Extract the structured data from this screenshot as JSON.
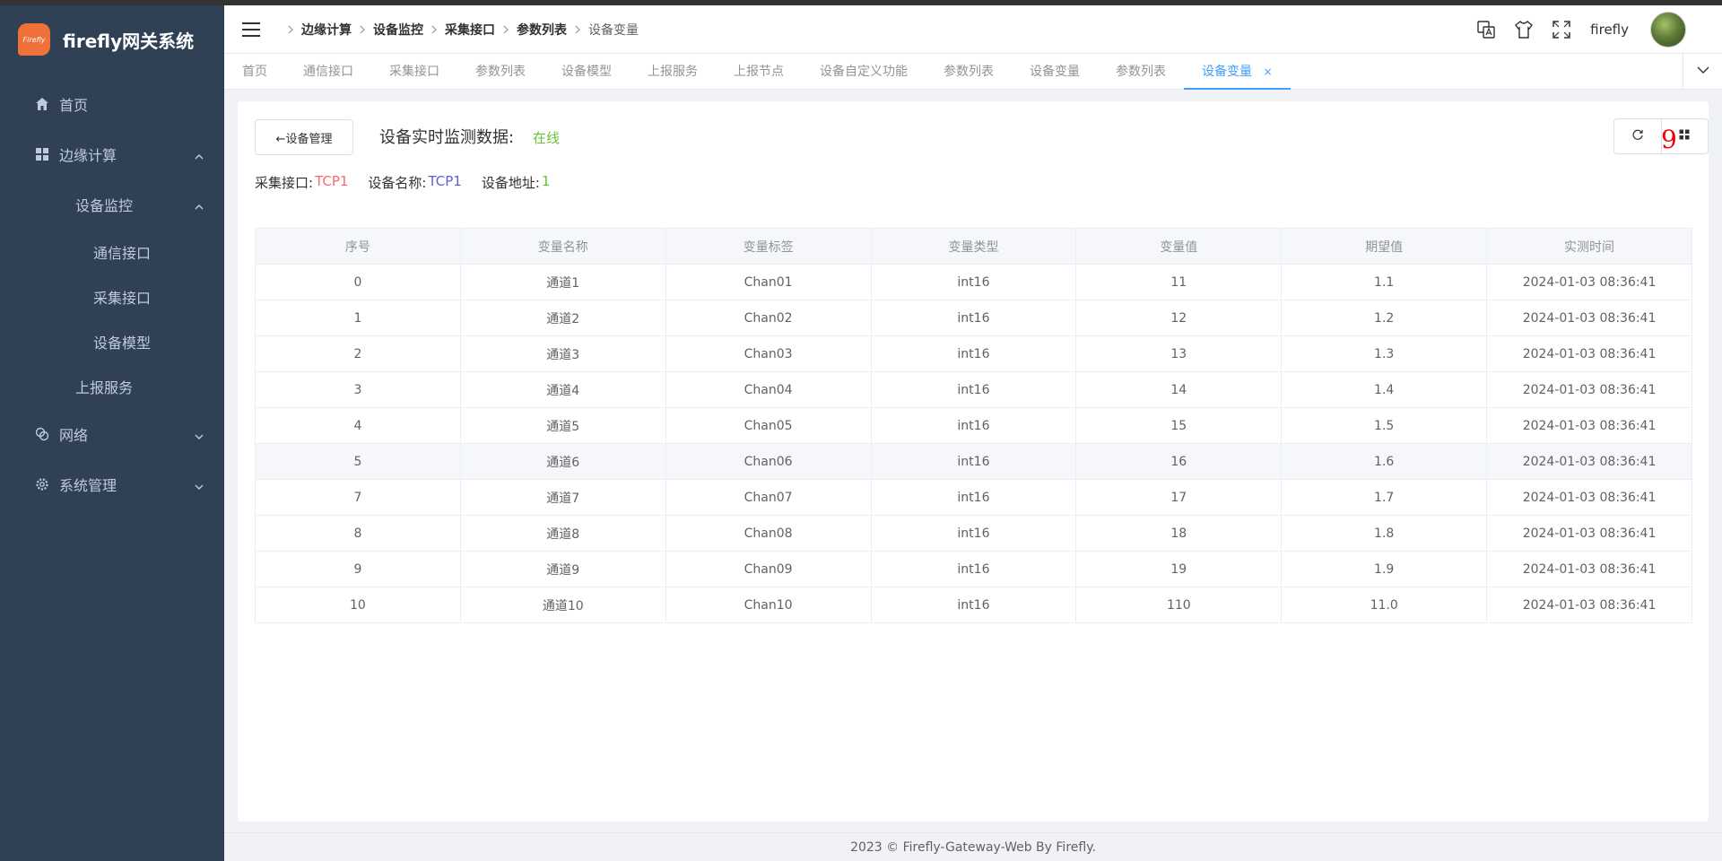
{
  "app": {
    "title": "firefly网关系统",
    "logo_text": "Firefly"
  },
  "sidebar": {
    "home": "首页",
    "edge": "边缘计算",
    "device_monitor": "设备监控",
    "comm_interface": "通信接口",
    "collect_interface": "采集接口",
    "device_model": "设备模型",
    "report_service": "上报服务",
    "network": "网络",
    "system_mgmt": "系统管理"
  },
  "breadcrumb": [
    "边缘计算",
    "设备监控",
    "采集接口",
    "参数列表",
    "设备变量"
  ],
  "header": {
    "username": "firefly"
  },
  "tabs": [
    {
      "label": "首页"
    },
    {
      "label": "通信接口"
    },
    {
      "label": "采集接口"
    },
    {
      "label": "参数列表"
    },
    {
      "label": "设备模型"
    },
    {
      "label": "上报服务"
    },
    {
      "label": "上报节点"
    },
    {
      "label": "设备自定义功能"
    },
    {
      "label": "参数列表"
    },
    {
      "label": "设备变量"
    },
    {
      "label": "参数列表"
    },
    {
      "label": "设备变量",
      "close": "×"
    }
  ],
  "main": {
    "back_label": "←设备管理",
    "monitor_title": "设备实时监测数据:",
    "status": "在线",
    "collect_label": "采集接口:",
    "collect_value": "TCP1",
    "device_name_label": "设备名称:",
    "device_name_value": "TCP1",
    "device_addr_label": "设备地址:",
    "device_addr_value": "1",
    "tool_number": "9"
  },
  "table": {
    "headers": [
      "序号",
      "变量名称",
      "变量标签",
      "变量类型",
      "变量值",
      "期望值",
      "实测时间"
    ],
    "rows": [
      [
        "0",
        "通道1",
        "Chan01",
        "int16",
        "11",
        "1.1",
        "2024-01-03 08:36:41"
      ],
      [
        "1",
        "通道2",
        "Chan02",
        "int16",
        "12",
        "1.2",
        "2024-01-03 08:36:41"
      ],
      [
        "2",
        "通道3",
        "Chan03",
        "int16",
        "13",
        "1.3",
        "2024-01-03 08:36:41"
      ],
      [
        "3",
        "通道4",
        "Chan04",
        "int16",
        "14",
        "1.4",
        "2024-01-03 08:36:41"
      ],
      [
        "4",
        "通道5",
        "Chan05",
        "int16",
        "15",
        "1.5",
        "2024-01-03 08:36:41"
      ],
      [
        "5",
        "通道6",
        "Chan06",
        "int16",
        "16",
        "1.6",
        "2024-01-03 08:36:41"
      ],
      [
        "7",
        "通道7",
        "Chan07",
        "int16",
        "17",
        "1.7",
        "2024-01-03 08:36:41"
      ],
      [
        "8",
        "通道8",
        "Chan08",
        "int16",
        "18",
        "1.8",
        "2024-01-03 08:36:41"
      ],
      [
        "9",
        "通道9",
        "Chan09",
        "int16",
        "19",
        "1.9",
        "2024-01-03 08:36:41"
      ],
      [
        "10",
        "通道10",
        "Chan10",
        "int16",
        "110",
        "11.0",
        "2024-01-03 08:36:41"
      ]
    ]
  },
  "footer": "2023 © Firefly-Gateway-Web By Firefly.",
  "colors": {
    "sidebar_bg": "#304156",
    "accent": "#409eff",
    "online": "#67c23a",
    "danger": "#f56c6c"
  },
  "icons": [
    "home-icon",
    "grid-icon",
    "chevron-up-icon",
    "chevron-down-icon",
    "network-icon",
    "gear-icon",
    "hamburger-icon",
    "chevron-right-icon",
    "translate-icon",
    "shirt-icon",
    "fullscreen-icon",
    "refresh-icon",
    "grid-view-icon"
  ]
}
